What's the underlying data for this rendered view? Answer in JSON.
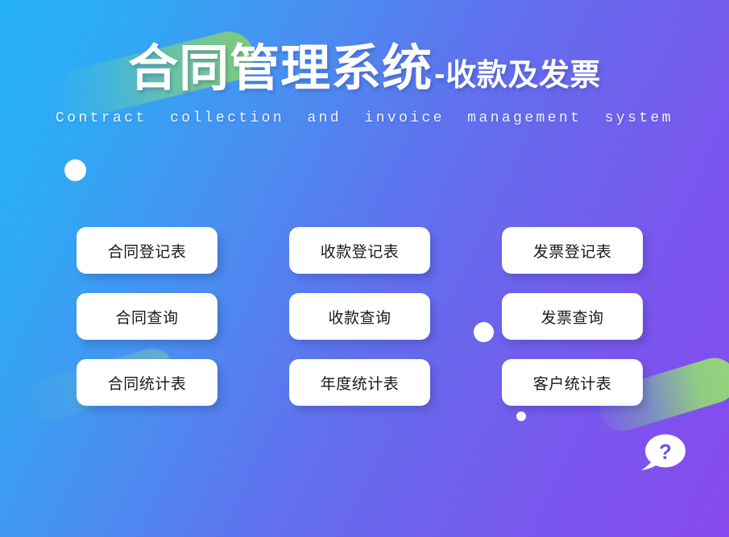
{
  "header": {
    "title_main": "合同管理系统",
    "title_dash": "-",
    "title_sub": "收款及发票",
    "subtitle_en": "Contract  collection  and  invoice  management  system"
  },
  "menu": {
    "items": [
      {
        "label": "合同登记表",
        "name": "contract-register-table"
      },
      {
        "label": "收款登记表",
        "name": "collection-register-table"
      },
      {
        "label": "发票登记表",
        "name": "invoice-register-table"
      },
      {
        "label": "合同查询",
        "name": "contract-query"
      },
      {
        "label": "收款查询",
        "name": "collection-query"
      },
      {
        "label": "发票查询",
        "name": "invoice-query"
      },
      {
        "label": "合同统计表",
        "name": "contract-statistics-table"
      },
      {
        "label": "年度统计表",
        "name": "annual-statistics-table"
      },
      {
        "label": "客户统计表",
        "name": "customer-statistics-table"
      }
    ]
  },
  "help": {
    "glyph": "?",
    "icon": "question-speech-bubble-icon"
  },
  "colors": {
    "bg_start": "#25b2f7",
    "bg_mid": "#6d63ec",
    "bg_end": "#8749ef",
    "button_bg": "#ffffff",
    "button_text": "#1a1a1a",
    "title_text": "#ffffff",
    "accent_green": "#92d37d",
    "help_mark": "#6b52e8"
  }
}
